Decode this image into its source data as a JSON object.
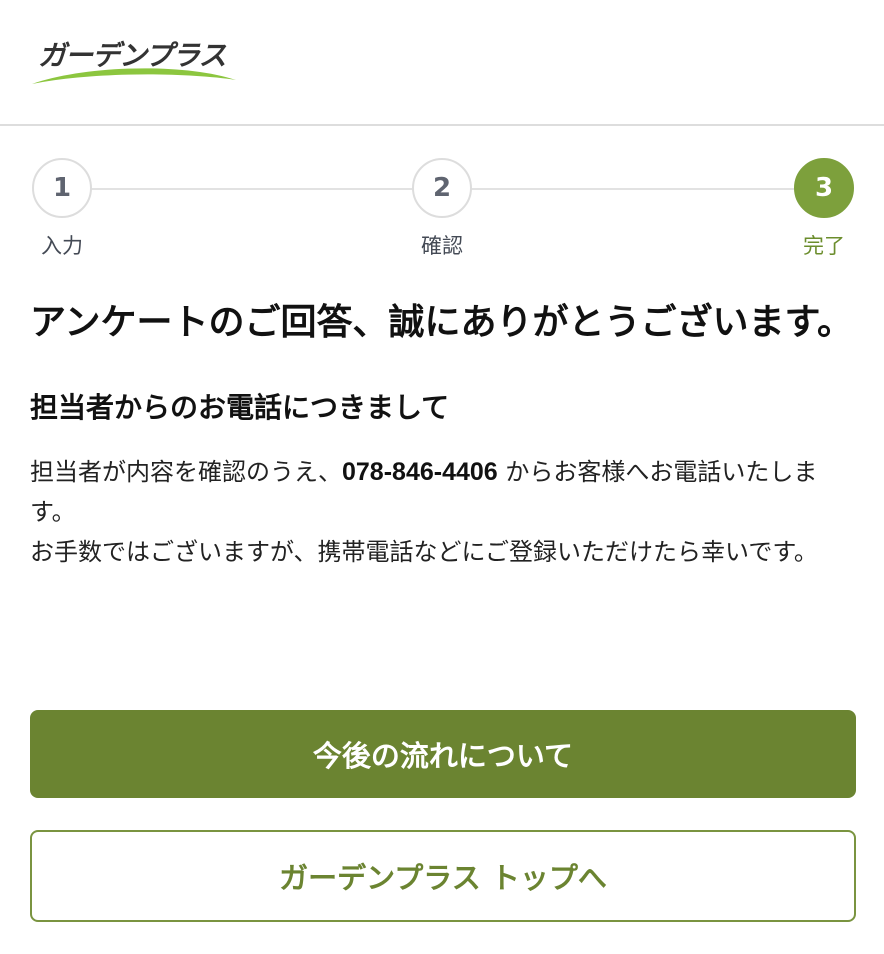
{
  "header": {
    "logo_text": "ガーデンプラス"
  },
  "stepper": {
    "steps": [
      {
        "number": "1",
        "label": "入力"
      },
      {
        "number": "2",
        "label": "確認"
      },
      {
        "number": "3",
        "label": "完了"
      }
    ],
    "active_step": 3
  },
  "main": {
    "title": "アンケートのご回答、誠にありがとうございます。",
    "subtitle": "担当者からのお電話につきまして",
    "paragraph_before_phone": "担当者が内容を確認のうえ、",
    "phone": "078-846-4406",
    "paragraph_after_phone": " からお客様へお電話いたします。",
    "paragraph2": "お手数ではございますが、携帯電話などにご登録いただけたら幸いです。"
  },
  "buttons": {
    "primary_label": "今後の流れについて",
    "secondary_label": "ガーデンプラス トップへ"
  },
  "colors": {
    "accent": "#6b8431",
    "step_active": "#7da03c",
    "logo_swoosh": "#8cc63f"
  }
}
